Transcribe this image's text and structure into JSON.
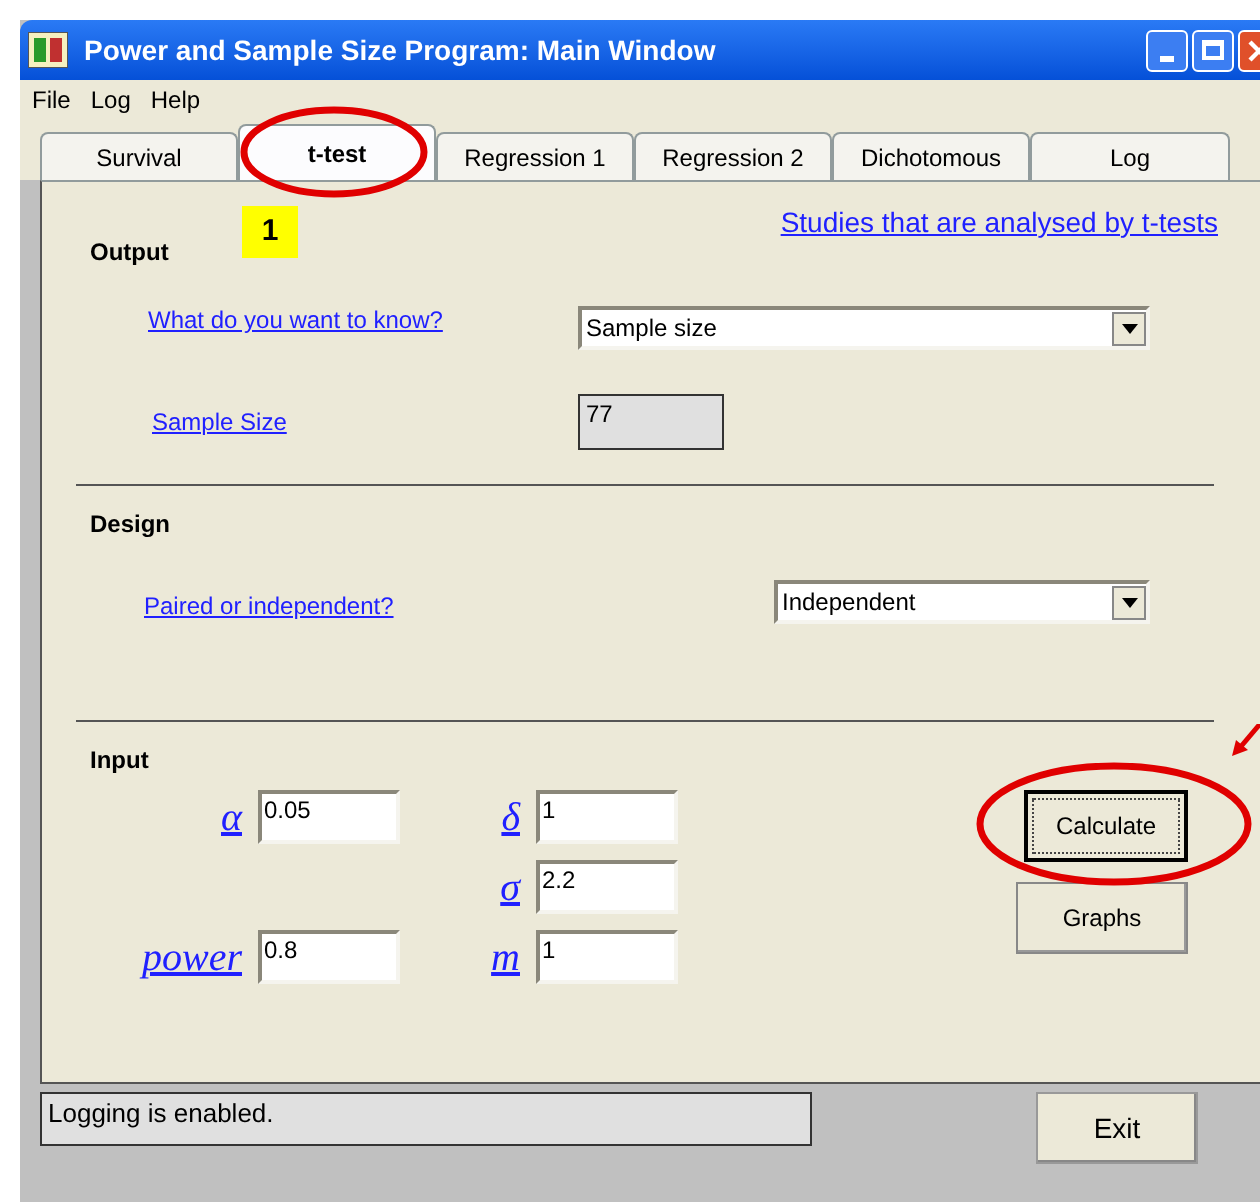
{
  "window": {
    "title": "Power and Sample Size Program:  Main Window"
  },
  "menu": [
    "File",
    "Log",
    "Help"
  ],
  "tabs": [
    {
      "label": "Survival",
      "selected": false
    },
    {
      "label": "t-test",
      "selected": true
    },
    {
      "label": "Regression 1",
      "selected": false
    },
    {
      "label": "Regression 2",
      "selected": false
    },
    {
      "label": "Dichotomous",
      "selected": false
    },
    {
      "label": "Log",
      "selected": false
    }
  ],
  "annotation_badge": "1",
  "help_link": "Studies that are analysed by t-tests",
  "output": {
    "heading": "Output",
    "question_label": "What do you want to know?",
    "question_value": "Sample size",
    "result_label": "Sample Size",
    "result_value": "77"
  },
  "design": {
    "heading": "Design",
    "label": "Paired or independent?",
    "value": "Independent"
  },
  "input": {
    "heading": "Input",
    "rows": [
      {
        "left": {
          "symbol": "α",
          "value": "0.05"
        },
        "right": {
          "symbol": "δ",
          "value": "1"
        }
      },
      {
        "right": {
          "symbol": "σ",
          "value": "2.2"
        }
      },
      {
        "left": {
          "symbol": "power",
          "value": "0.8"
        },
        "right": {
          "symbol": "m",
          "value": "1"
        }
      }
    ]
  },
  "buttons": [
    {
      "label": "Calculate",
      "focused": true
    },
    {
      "label": "Graphs",
      "focused": false
    }
  ],
  "status": "Logging is enabled.",
  "exit_button": "Exit"
}
